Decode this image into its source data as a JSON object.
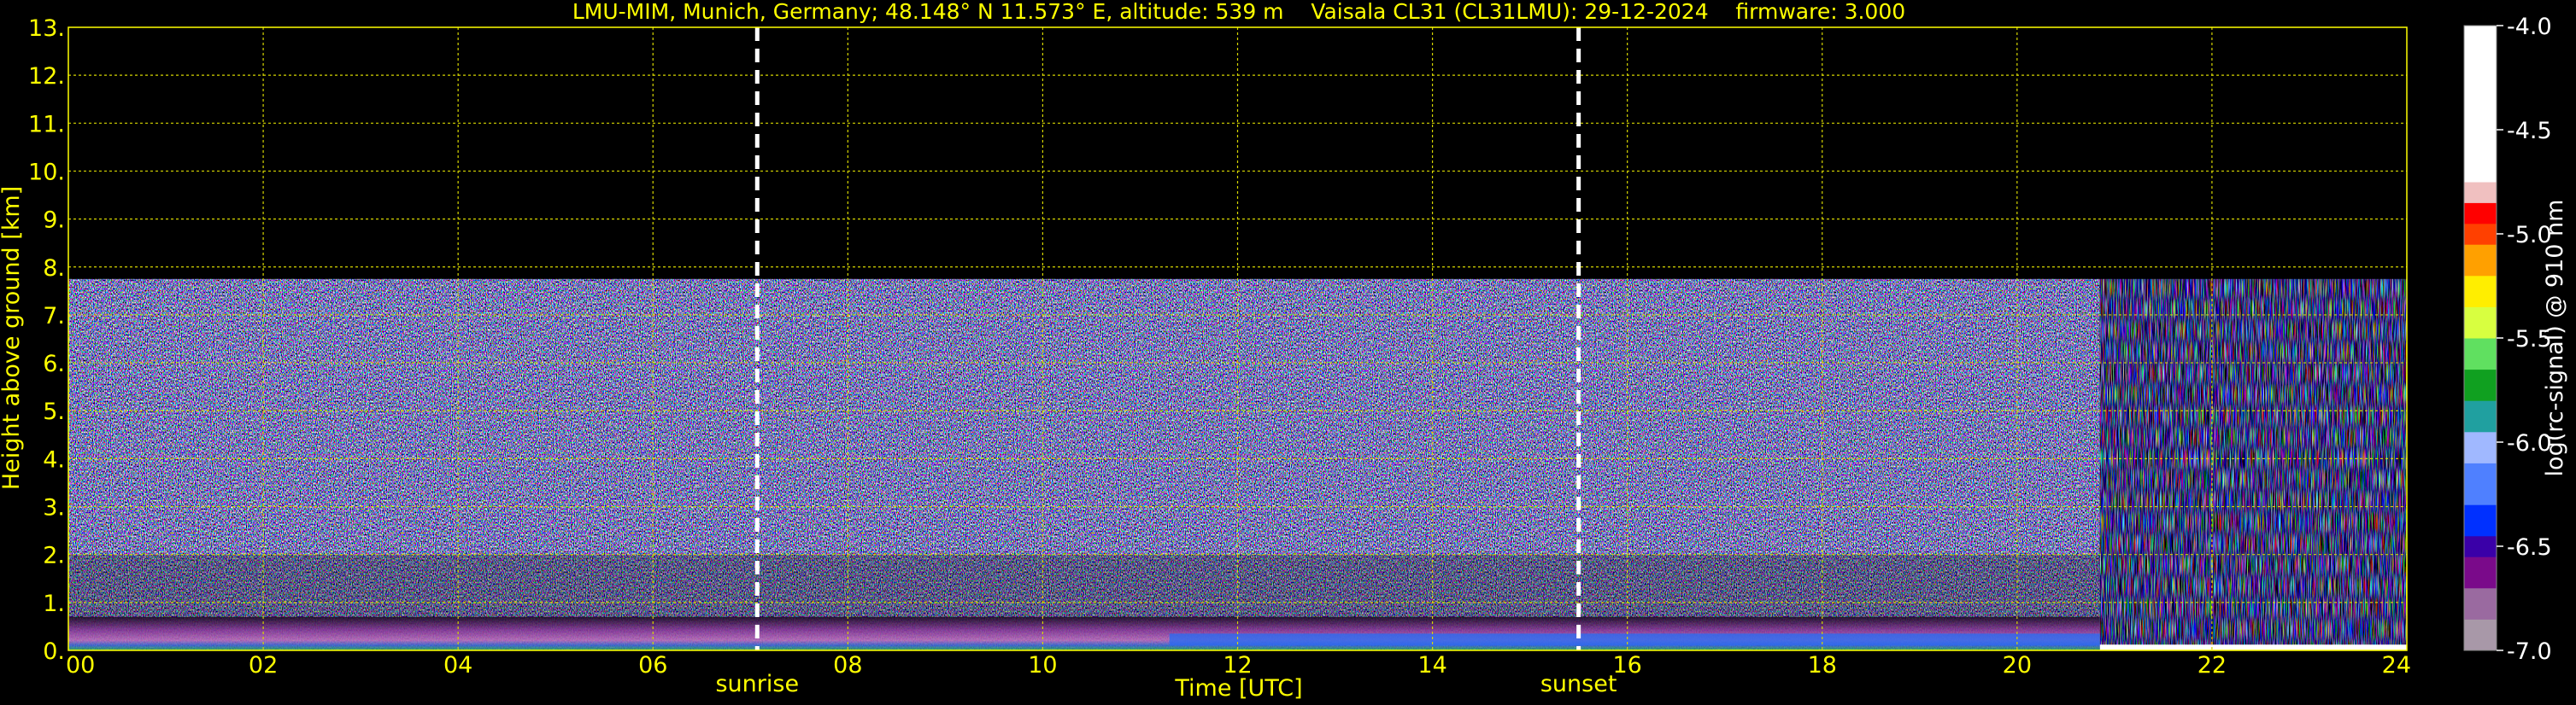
{
  "chart_data": {
    "type": "heatmap",
    "title": "LMU-MIM, Munich, Germany; 48.148° N 11.573° E, altitude: 539 m    Vaisala CL31 (CL31LMU): 29-12-2024    firmware: 3.000",
    "xlabel": "Time [UTC]",
    "ylabel": "Height above ground [km]",
    "xlim": [
      0,
      24
    ],
    "ylim": [
      0,
      13
    ],
    "x_ticks": [
      "00",
      "02",
      "04",
      "06",
      "08",
      "10",
      "12",
      "14",
      "16",
      "18",
      "20",
      "22",
      "24"
    ],
    "y_ticks": [
      "0.",
      "1.",
      "2.",
      "3.",
      "4.",
      "5.",
      "6.",
      "7.",
      "8.",
      "9.",
      "10.",
      "11.",
      "12.",
      "13."
    ],
    "grid": true,
    "signal_top_km": 7.75,
    "vertical_markers": [
      {
        "label": "sunrise",
        "time": 7.07
      },
      {
        "label": "sunset",
        "time": 15.5
      }
    ],
    "colorbar": {
      "label": "log(rc-signal) @ 910 nm",
      "range": [
        -7.0,
        -4.0
      ],
      "ticks": [
        "-4.0",
        "-4.5",
        "-5.0",
        "-5.5",
        "-6.0",
        "-6.5",
        "-7.0"
      ],
      "stops": [
        {
          "value": -7.0,
          "color": "#a898a8"
        },
        {
          "value": -6.85,
          "color": "#9a6aa0"
        },
        {
          "value": -6.7,
          "color": "#7a0a8a"
        },
        {
          "value": -6.55,
          "color": "#3a00a8"
        },
        {
          "value": -6.45,
          "color": "#0030ff"
        },
        {
          "value": -6.3,
          "color": "#4f80ff"
        },
        {
          "value": -6.1,
          "color": "#a0b8ff"
        },
        {
          "value": -5.95,
          "color": "#20a0a0"
        },
        {
          "value": -5.8,
          "color": "#10a020"
        },
        {
          "value": -5.65,
          "color": "#60e060"
        },
        {
          "value": -5.5,
          "color": "#d8ff40"
        },
        {
          "value": -5.35,
          "color": "#ffee00"
        },
        {
          "value": -5.2,
          "color": "#ffa000"
        },
        {
          "value": -5.05,
          "color": "#ff4000"
        },
        {
          "value": -4.95,
          "color": "#ff0000"
        },
        {
          "value": -4.85,
          "color": "#f0c0c0"
        },
        {
          "value": -4.75,
          "color": "#ffffff"
        },
        {
          "value": -4.0,
          "color": "#ffffff"
        }
      ]
    }
  }
}
